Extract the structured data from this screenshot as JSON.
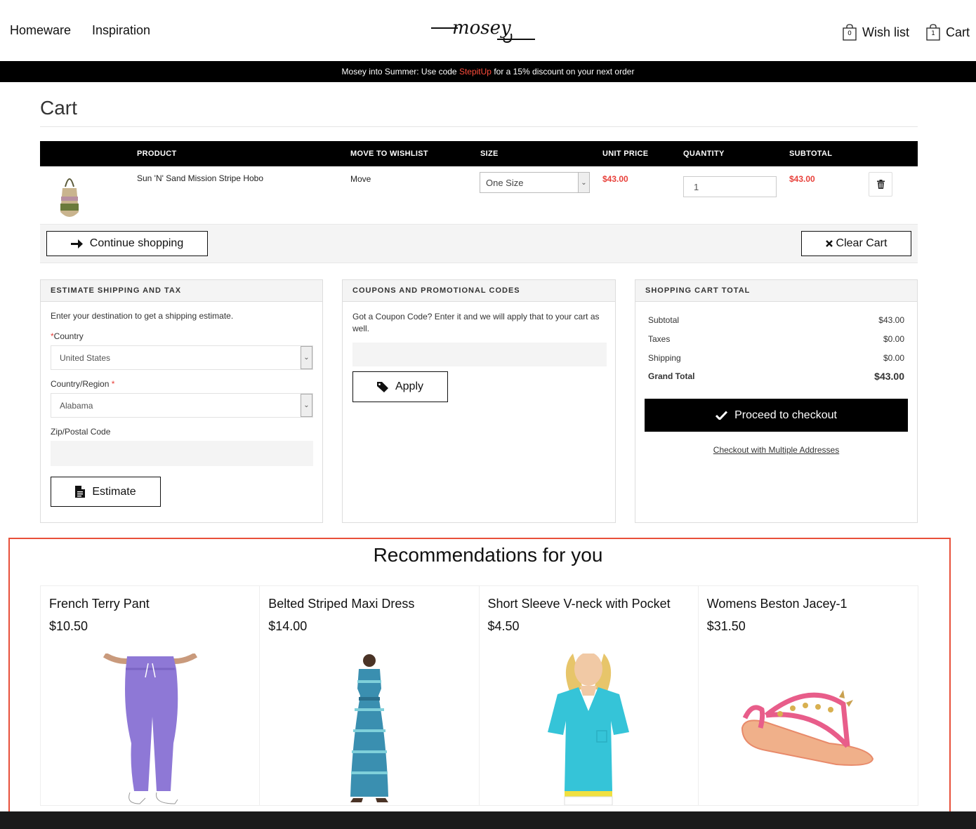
{
  "header": {
    "nav": [
      "Homeware",
      "Inspiration"
    ],
    "logo_alt": "mosey",
    "wishlist_label": "Wish list",
    "wishlist_count": "0",
    "cart_label": "Cart",
    "cart_count": "1"
  },
  "promo": {
    "before": "Mosey into Summer: Use code ",
    "code": "StepitUp",
    "after": " for a 15% discount on your next order"
  },
  "page_title": "Cart",
  "table": {
    "headers": [
      "PRODUCT",
      "MOVE TO WISHLIST",
      "SIZE",
      "UNIT PRICE",
      "QUANTITY",
      "SUBTOTAL"
    ],
    "rows": [
      {
        "product": "Sun 'N' Sand Mission Stripe Hobo",
        "move": "Move",
        "size": "One Size",
        "unit_price": "$43.00",
        "quantity": "1",
        "subtotal": "$43.00"
      }
    ]
  },
  "actions": {
    "continue": "Continue shopping",
    "clear": "Clear Cart"
  },
  "shipping": {
    "heading": "ESTIMATE SHIPPING AND TAX",
    "intro": "Enter your destination to get a shipping estimate.",
    "country_label": "Country",
    "country_value": "United States",
    "region_label": "Country/Region",
    "region_value": "Alabama",
    "zip_label": "Zip/Postal Code",
    "zip_value": "",
    "button": "Estimate"
  },
  "coupons": {
    "heading": "COUPONS AND PROMOTIONAL CODES",
    "intro": "Got a Coupon Code? Enter it and we will apply that to your cart as well.",
    "code_value": "",
    "button": "Apply"
  },
  "totals": {
    "heading": "SHOPPING CART TOTAL",
    "rows": [
      {
        "label": "Subtotal",
        "value": "$43.00"
      },
      {
        "label": "Taxes",
        "value": "$0.00"
      },
      {
        "label": "Shipping",
        "value": "$0.00"
      }
    ],
    "grand_label": "Grand Total",
    "grand_value": "$43.00",
    "checkout": "Proceed to checkout",
    "multi": "Checkout with Multiple Addresses"
  },
  "recommendations": {
    "title": "Recommendations for you",
    "items": [
      {
        "name": "French Terry Pant",
        "price": "$10.50"
      },
      {
        "name": "Belted Striped Maxi Dress",
        "price": "$14.00"
      },
      {
        "name": "Short Sleeve V-neck with Pocket",
        "price": "$4.50"
      },
      {
        "name": "Womens Beston Jacey-1",
        "price": "$31.50"
      }
    ]
  },
  "colors": {
    "accent_red": "#e8413b",
    "promo_code": "#ff4c3b",
    "highlight_frame": "#e8503a"
  }
}
